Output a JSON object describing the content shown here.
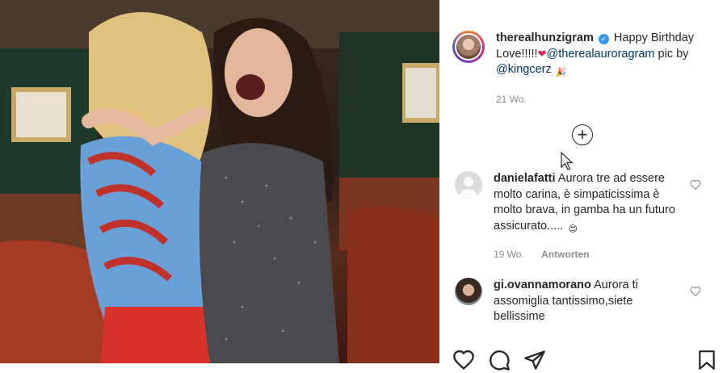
{
  "post": {
    "username": "therealhunzigram",
    "caption_text": "Happy Birthday Love!!!!!",
    "caption_heart": "❤",
    "mention_1": "@therealauroragram",
    "caption_mid": "pic by",
    "mention_2": "@kingcerz",
    "caption_emoji": "🎉",
    "age": "21 Wo.",
    "verified_symbol": "✓"
  },
  "load_more_symbol": "+",
  "comments": [
    {
      "username": "danielafatti",
      "text": "Aurora tre ad essere molto carina, è simpaticissima è molto brava, in gamba ha un futuro assicurato.....",
      "emoji": "😍",
      "age": "19 Wo.",
      "reply_label": "Antworten"
    },
    {
      "username": "gi.ovannamorano",
      "text": "Aurora ti assomiglia tantissimo,siete bellissime"
    }
  ],
  "colors": {
    "link": "#00376b",
    "muted": "#8e8e8e",
    "verified": "#3897f0"
  },
  "icons": [
    "heart-icon",
    "comment-icon",
    "share-icon",
    "bookmark-icon",
    "plus-circle-icon",
    "cursor-icon"
  ]
}
